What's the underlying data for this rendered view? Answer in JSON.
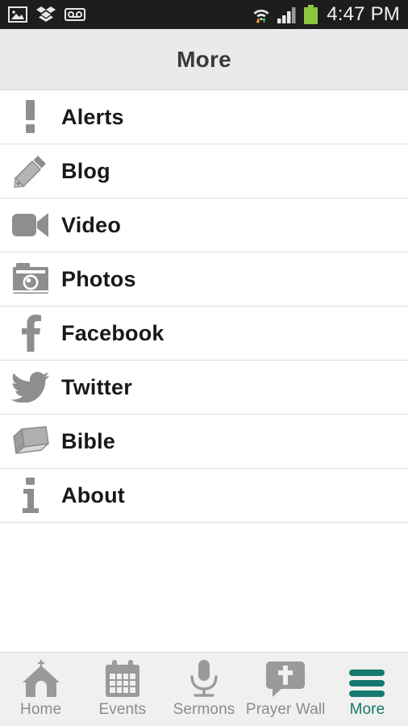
{
  "statusbar": {
    "time": "4:47 PM",
    "left_icons": [
      {
        "name": "gallery-image-icon"
      },
      {
        "name": "dropbox-icon"
      },
      {
        "name": "voicemail-icon"
      }
    ],
    "right_icons": [
      {
        "name": "wifi-data-transfer-icon"
      },
      {
        "name": "cellular-signal-icon"
      },
      {
        "name": "battery-icon"
      }
    ],
    "background_color": "#1d1d1d",
    "battery_color": "#8cc63e"
  },
  "header": {
    "title": "More",
    "background_color": "#eaeaea",
    "text_color": "#3a3a3a"
  },
  "menu": {
    "items": [
      {
        "label": "Alerts",
        "icon": "exclamation-icon"
      },
      {
        "label": "Blog",
        "icon": "pencil-icon"
      },
      {
        "label": "Video",
        "icon": "video-camera-icon"
      },
      {
        "label": "Photos",
        "icon": "camera-icon"
      },
      {
        "label": "Facebook",
        "icon": "facebook-icon"
      },
      {
        "label": "Twitter",
        "icon": "twitter-bird-icon"
      },
      {
        "label": "Bible",
        "icon": "book-icon"
      },
      {
        "label": "About",
        "icon": "info-icon"
      }
    ],
    "icon_color": "#8e8e8e",
    "text_color": "#191919",
    "divider_color": "#dedede"
  },
  "tabbar": {
    "items": [
      {
        "label": "Home",
        "icon": "church-icon",
        "active": false
      },
      {
        "label": "Events",
        "icon": "calendar-icon",
        "active": false
      },
      {
        "label": "Sermons",
        "icon": "microphone-icon",
        "active": false
      },
      {
        "label": "Prayer Wall",
        "icon": "speech-cross-icon",
        "active": false
      },
      {
        "label": "More",
        "icon": "hamburger-icon",
        "active": true
      }
    ],
    "inactive_color": "#8c8c8c",
    "active_color": "#16796f",
    "background_color": "#f0f0f0"
  }
}
